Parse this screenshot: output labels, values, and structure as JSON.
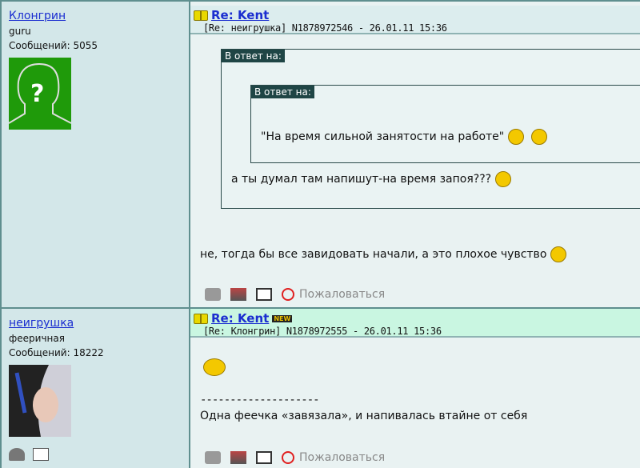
{
  "posts": [
    {
      "author": "Клонгрин",
      "rank": "guru",
      "messages": "Сообщений: 5055",
      "title": "Re: Kent",
      "meta": "[Re: неигрушка]  N1878972546 - 26.01.11 15:36",
      "quote_label": "В ответ на:",
      "inner_quote_label": "В ответ на:",
      "inner_quote": "\"На время сильной занятости на работе\"",
      "outer_quote": "а ты думал там напишут-на время запоя???",
      "body": "не, тогда бы все завидовать начали, а это плохое чувство",
      "report": "Пожаловаться"
    },
    {
      "author": "неигрушка",
      "rank": "фееричная",
      "messages": "Сообщений: 18222",
      "title": "Re: Kent",
      "badge": "NEW",
      "meta": "[Re: Клонгрин]  N1878972555 - 26.01.11 15:36",
      "separator": "--------------------",
      "body": "Одна феечка «завязала», и напивалась втайне от себя",
      "report": "Пожаловаться"
    }
  ]
}
